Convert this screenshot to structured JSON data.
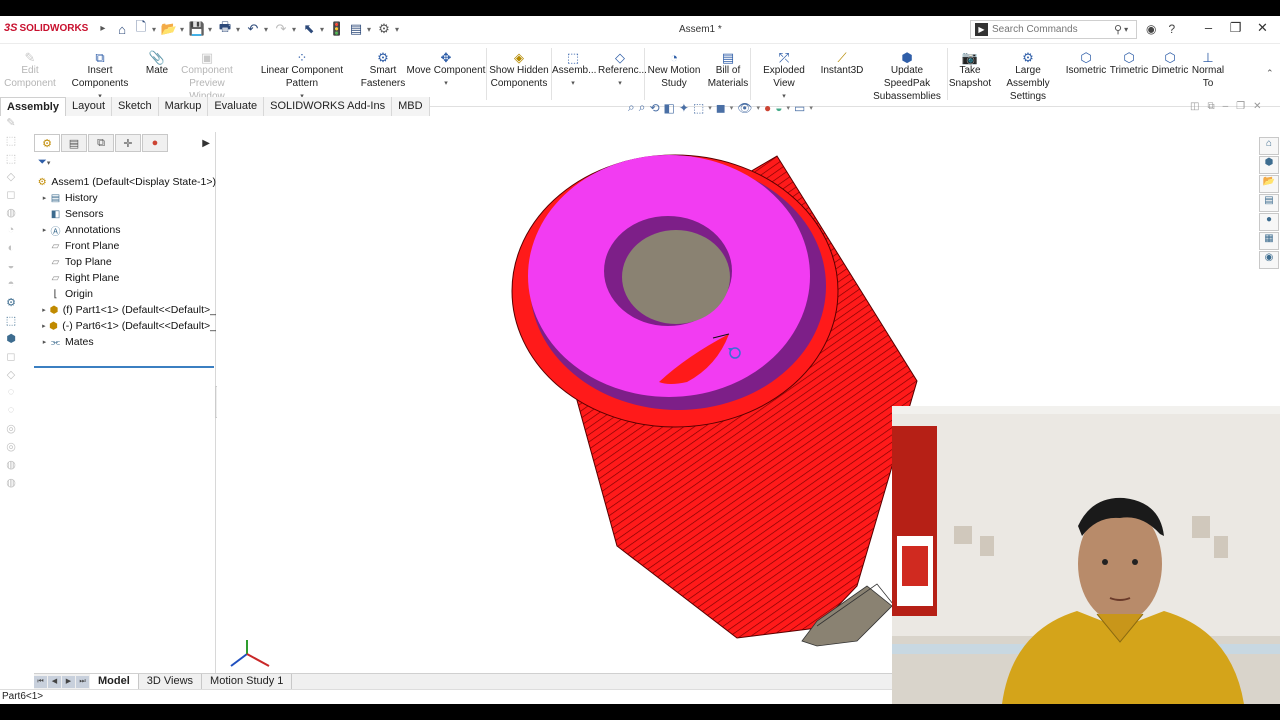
{
  "app": {
    "logo_text": "SOLIDWORKS",
    "logo_mark": "3S",
    "document_title": "Assem1 *"
  },
  "search": {
    "placeholder": "Search Commands"
  },
  "ribbon": {
    "edit_component": [
      "Edit",
      "Component"
    ],
    "insert_components": "Insert Components",
    "mate": "Mate",
    "component_preview": [
      "Component",
      "Preview Window"
    ],
    "linear_pattern": "Linear Component Pattern",
    "smart_fasteners": [
      "Smart",
      "Fasteners"
    ],
    "move_component": "Move Component",
    "show_hidden": [
      "Show Hidden",
      "Components"
    ],
    "assembly": "Assemb...",
    "reference": "Referenc...",
    "new_motion_study": [
      "New Motion",
      "Study"
    ],
    "bill_of_materials": [
      "Bill of",
      "Materials"
    ],
    "exploded_view": "Exploded View",
    "instant3d": "Instant3D",
    "update_speedpak": [
      "Update SpeedPak",
      "Subassemblies"
    ],
    "take_snapshot": [
      "Take",
      "Snapshot"
    ],
    "large_assembly": [
      "Large Assembly",
      "Settings"
    ],
    "isometric": "Isometric",
    "trimetric": "Trimetric",
    "dimetric": "Dimetric",
    "normal_to": [
      "Normal",
      "To"
    ]
  },
  "command_tabs": [
    "Assembly",
    "Layout",
    "Sketch",
    "Markup",
    "Evaluate",
    "SOLIDWORKS Add-Ins",
    "MBD"
  ],
  "feature_tree": {
    "root": "Assem1  (Default<Display State-1>)",
    "items": [
      {
        "label": "History",
        "expandable": true
      },
      {
        "label": "Sensors",
        "expandable": false
      },
      {
        "label": "Annotations",
        "expandable": true
      },
      {
        "label": "Front Plane",
        "expandable": false
      },
      {
        "label": "Top Plane",
        "expandable": false
      },
      {
        "label": "Right Plane",
        "expandable": false
      },
      {
        "label": "Origin",
        "expandable": false
      },
      {
        "label": "(f) Part1<1> (Default<<Default>_",
        "expandable": true
      },
      {
        "label": "(-) Part6<1> (Default<<Default>_",
        "expandable": true
      },
      {
        "label": "Mates",
        "expandable": true
      }
    ]
  },
  "bottom_tabs": [
    "Model",
    "3D Views",
    "Motion Study 1"
  ],
  "status_bar": {
    "text": "Part6<1>"
  },
  "colors": {
    "part_red": "#ff1a1a",
    "face_magenta": "#f23cf2",
    "inner_purple": "#7d1f88",
    "selection_blue": "#3b7fc1"
  },
  "icons": [
    "home-icon",
    "new-icon",
    "open-icon",
    "save-icon",
    "print-icon",
    "undo-icon",
    "redo-icon",
    "select-icon",
    "rebuild-icon",
    "file-properties-icon",
    "options-icon",
    "search-icon",
    "user-icon",
    "help-icon"
  ]
}
